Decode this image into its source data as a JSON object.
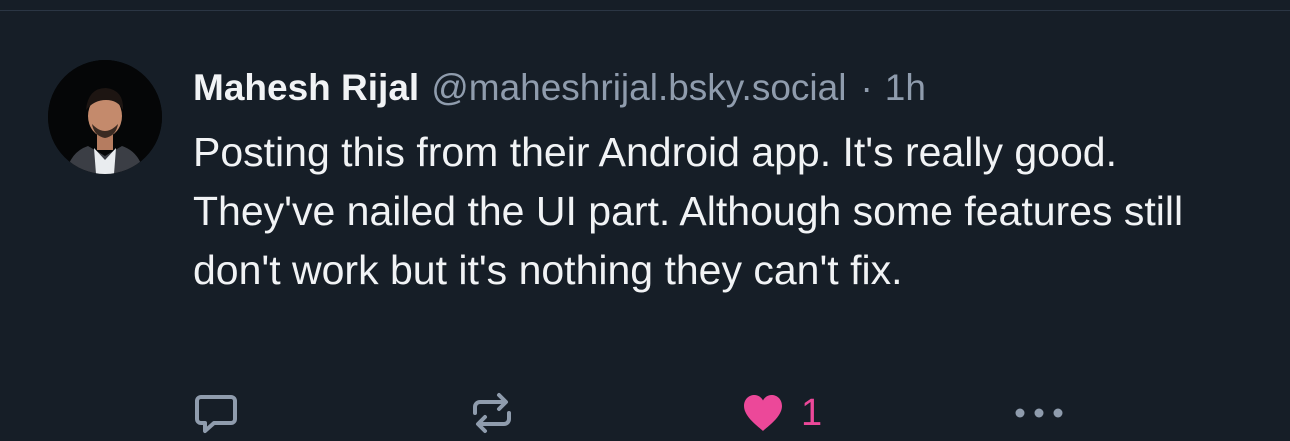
{
  "post": {
    "author": {
      "display_name": "Mahesh Rijal",
      "handle": "@maheshrijal.bsky.social"
    },
    "separator": "·",
    "time": "1h",
    "text": "Posting this from their Android app. It's really good. They've nailed the UI part. Although some features still don't work but it's nothing they can't fix.",
    "actions": {
      "reply_icon": "speech-bubble-icon",
      "repost_icon": "repost-arrows-icon",
      "like_icon": "heart-icon",
      "like_count": "1",
      "more_icon": "more-dots-icon"
    }
  },
  "colors": {
    "background": "#161e27",
    "text": "#f1f3f5",
    "muted": "#8f9cad",
    "like": "#ec4899"
  }
}
